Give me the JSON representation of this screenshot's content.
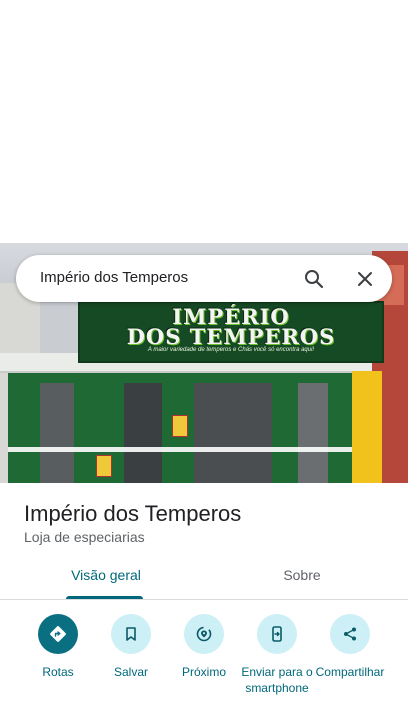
{
  "search": {
    "query": "Império dos Temperos"
  },
  "photo": {
    "sign_title_line1": "IMPÉRIO",
    "sign_title_line2": "DOS TEMPEROS",
    "sign_subtitle": "A maior variedade de temperos e Chás você só encontra aqui!"
  },
  "place": {
    "title": "Império dos Temperos",
    "category": "Loja de especiarias"
  },
  "tabs": [
    {
      "label": "Visão geral",
      "active": true
    },
    {
      "label": "Sobre",
      "active": false
    }
  ],
  "actions": [
    {
      "label": "Rotas",
      "icon": "directions-icon"
    },
    {
      "label": "Salvar",
      "icon": "bookmark-icon"
    },
    {
      "label": "Próximo",
      "icon": "nearby-icon"
    },
    {
      "label": "Enviar para o smartphone",
      "icon": "send-to-phone-icon"
    },
    {
      "label": "Compartilhar",
      "icon": "share-icon"
    }
  ],
  "colors": {
    "accent": "#00687a",
    "primary_button": "#0b6f82",
    "action_bg": "#ccf0f5"
  }
}
